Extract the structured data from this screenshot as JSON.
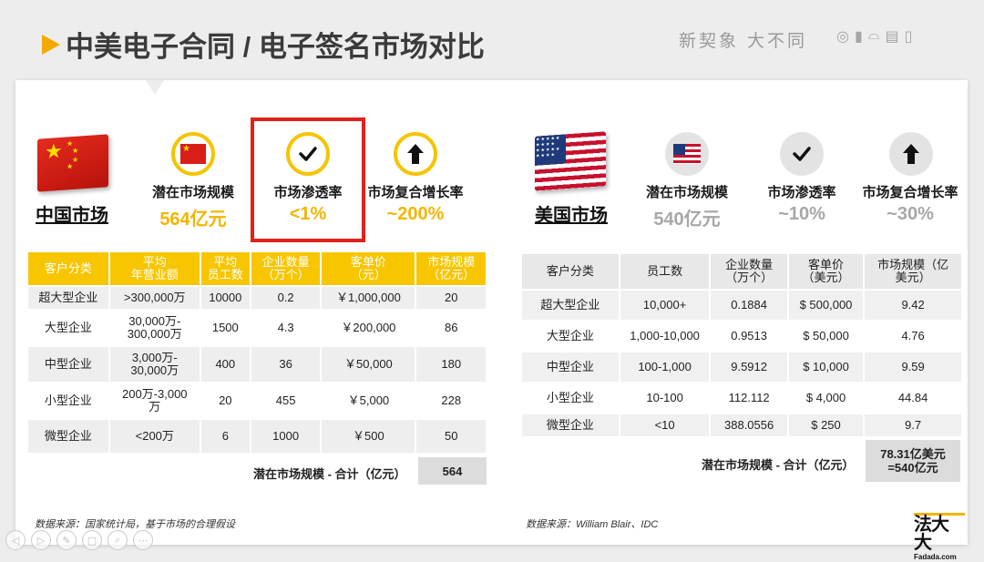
{
  "page_title": "中美电子合同 / 电子签名市场对比",
  "slogan": "新契象 大不同",
  "header_icons": [
    "◎",
    "▮",
    "⌓",
    "▤",
    "▯"
  ],
  "china": {
    "market_label": "中国市场",
    "metrics": [
      {
        "label": "潜在市场规模",
        "value": "564亿元",
        "icon": "china-flag-icon"
      },
      {
        "label": "市场渗透率",
        "value": "<1%",
        "icon": "checkmark-icon"
      },
      {
        "label": "市场复合增长率",
        "value": "~200%",
        "icon": "growth-arrow-icon"
      }
    ],
    "table": {
      "headers": [
        "客户分类",
        "平均\n年营业额",
        "平均\n员工数",
        "企业数量\n（万个）",
        "客单价\n（元）",
        "市场规模\n（亿元）"
      ],
      "rows": [
        [
          "超大型企业",
          ">300,000万",
          "10000",
          "0.2",
          "￥1,000,000",
          "20"
        ],
        [
          "大型企业",
          "30,000万-\n300,000万",
          "1500",
          "4.3",
          "￥200,000",
          "86"
        ],
        [
          "中型企业",
          "3,000万-\n30,000万",
          "400",
          "36",
          "￥50,000",
          "180"
        ],
        [
          "小型企业",
          "200万-3,000\n万",
          "20",
          "455",
          "￥5,000",
          "228"
        ],
        [
          "微型企业",
          "<200万",
          "6",
          "1000",
          "￥500",
          "50"
        ]
      ],
      "total_label": "潜在市场规模 - 合计（亿元）",
      "total_value": "564"
    },
    "source": "数据来源：国家统计局，基于市场的合理假设"
  },
  "usa": {
    "market_label": "美国市场",
    "metrics": [
      {
        "label": "潜在市场规模",
        "value": "540亿元",
        "icon": "usa-flag-icon"
      },
      {
        "label": "市场渗透率",
        "value": "~10%",
        "icon": "checkmark-icon"
      },
      {
        "label": "市场复合增长率",
        "value": "~30%",
        "icon": "growth-arrow-icon"
      }
    ],
    "table": {
      "headers": [
        "客户分类",
        "员工数",
        "企业数量\n（万个）",
        "客单价\n（美元）",
        "市场规模（亿\n美元）"
      ],
      "rows": [
        [
          "超大型企业",
          "10,000+",
          "0.1884",
          "$ 500,000",
          "9.42"
        ],
        [
          "大型企业",
          "1,000-10,000",
          "0.9513",
          "$ 50,000",
          "4.76"
        ],
        [
          "中型企业",
          "100-1,000",
          "9.5912",
          "$ 10,000",
          "9.59"
        ],
        [
          "小型企业",
          "10-100",
          "112.112",
          "$ 4,000",
          "44.84"
        ],
        [
          "微型企业",
          "<10",
          "388.0556",
          "$ 250",
          "9.7"
        ]
      ],
      "total_label": "潜在市场规模 - 合计（亿元）",
      "total_value": "78.31亿美元\n=540亿元"
    },
    "source": "数据来源：William Blair、IDC"
  },
  "logo": {
    "mark": "法大大",
    "text": "Fadada.com"
  },
  "colors": {
    "accent": "#f7c600",
    "highlight": "#e0221a",
    "us_value": "#a7a7a7"
  }
}
